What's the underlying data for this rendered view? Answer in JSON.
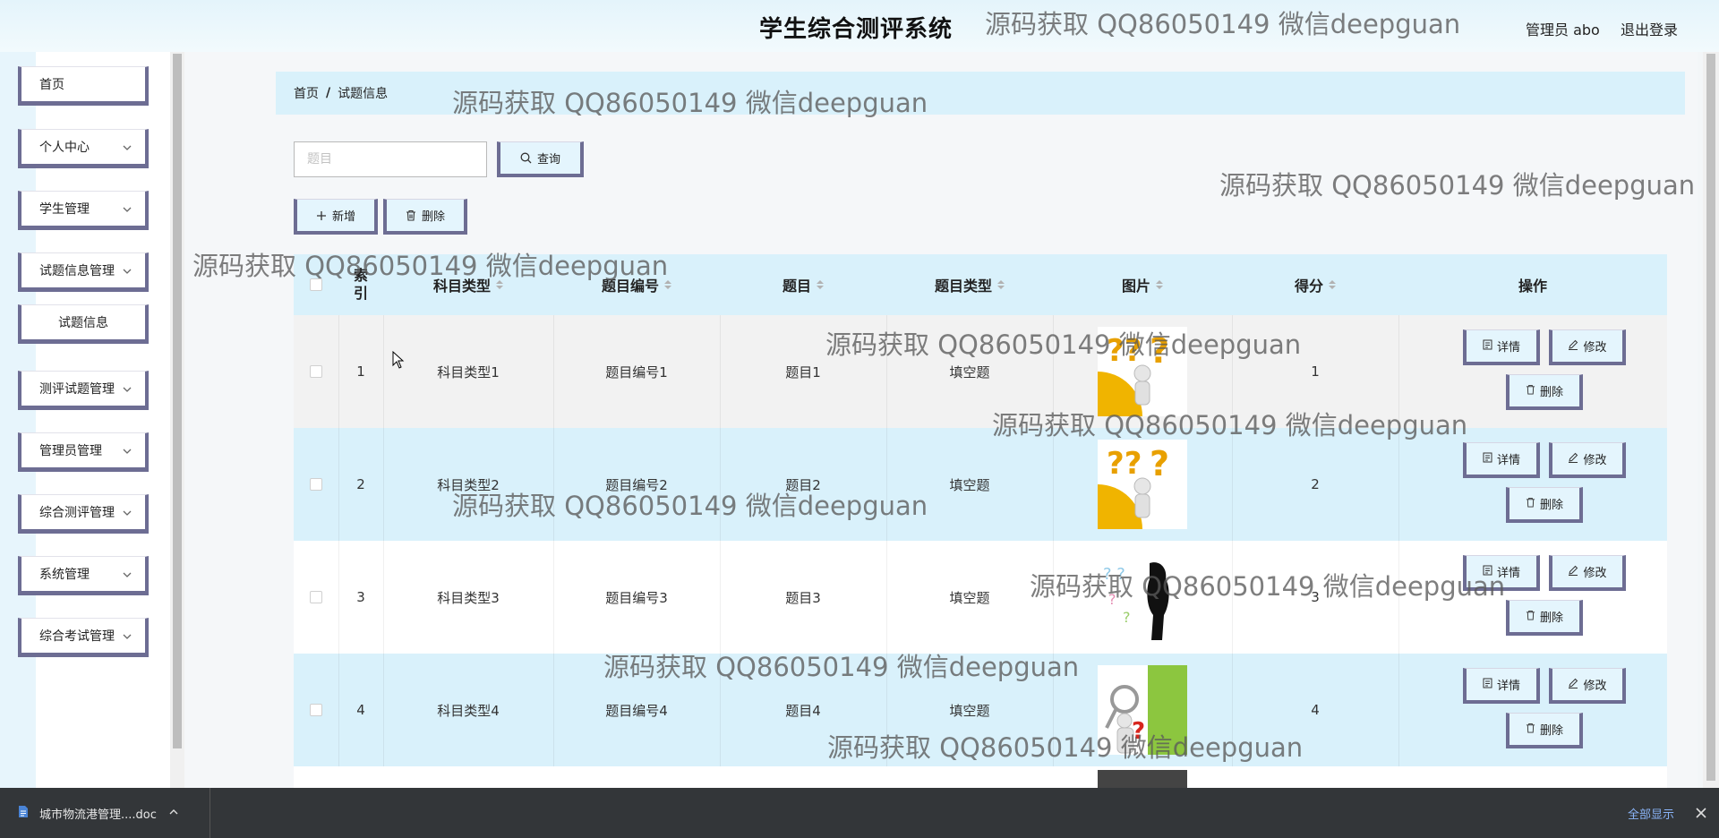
{
  "header": {
    "title": "学生综合测评系统",
    "admin_label": "管理员 abo",
    "logout": "退出登录"
  },
  "sidebar": {
    "items": [
      {
        "label": "首页"
      },
      {
        "label": "个人中心"
      },
      {
        "label": "学生管理"
      },
      {
        "label": "试题信息管理"
      },
      {
        "label": "试题信息"
      },
      {
        "label": "测评试题管理"
      },
      {
        "label": "管理员管理"
      },
      {
        "label": "综合测评管理"
      },
      {
        "label": "系统管理"
      },
      {
        "label": "综合考试管理"
      }
    ]
  },
  "breadcrumb": {
    "home": "首页",
    "sep": "/",
    "current": "试题信息"
  },
  "search": {
    "placeholder": "题目",
    "value": "",
    "button": "查询"
  },
  "toolbar": {
    "add": "新增",
    "delete": "删除"
  },
  "table": {
    "columns": [
      "索引",
      "科目类型",
      "题目编号",
      "题目",
      "题目类型",
      "图片",
      "得分",
      "操作"
    ],
    "rows": [
      {
        "index": "1",
        "subject": "科目类型1",
        "number": "题目编号1",
        "question": "题目1",
        "qtype": "填空题",
        "image": "question-mark-person",
        "score": "1"
      },
      {
        "index": "2",
        "subject": "科目类型2",
        "number": "题目编号2",
        "question": "题目2",
        "qtype": "填空题",
        "image": "question-mark-person",
        "score": "2"
      },
      {
        "index": "3",
        "subject": "科目类型3",
        "number": "题目编号3",
        "question": "题目3",
        "qtype": "填空题",
        "image": "silhouette-question",
        "score": "3"
      },
      {
        "index": "4",
        "subject": "科目类型4",
        "number": "题目编号4",
        "question": "题目4",
        "qtype": "填空题",
        "image": "magnifier-question",
        "score": "4"
      }
    ],
    "actions": {
      "detail": "详情",
      "edit": "修改",
      "delete": "删除"
    }
  },
  "watermark": "源码获取 QQ86050149 微信deepguan",
  "download_bar": {
    "file": "城市物流港管理....doc",
    "show_all": "全部显示"
  },
  "colors": {
    "accent": "#d9f1fb",
    "button_border": "#6d6d93",
    "header_bg": "#e4f4fb"
  }
}
